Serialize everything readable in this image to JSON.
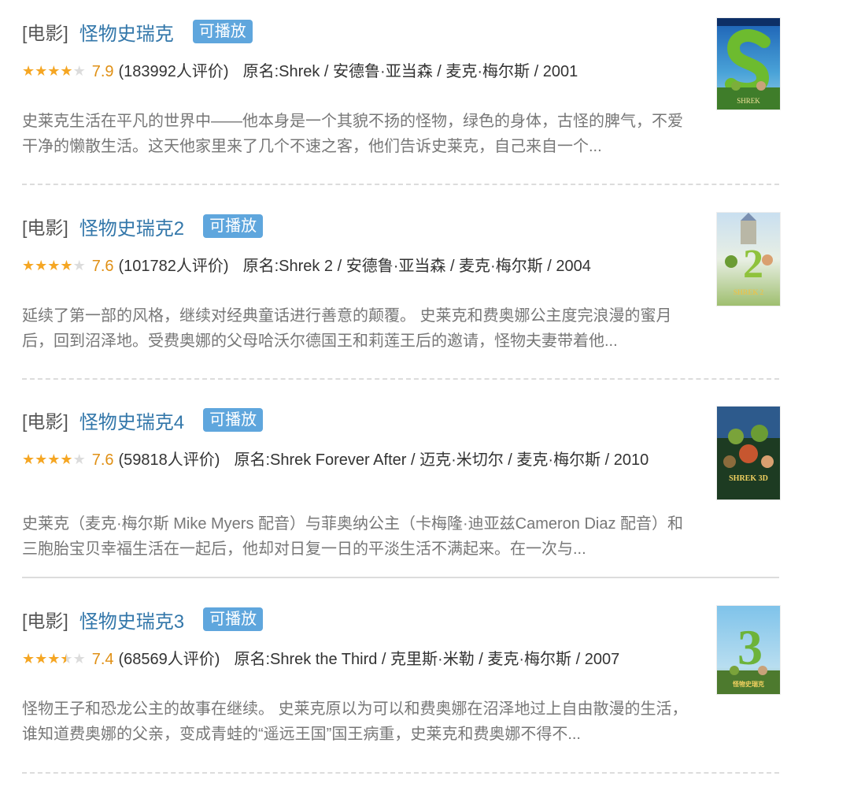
{
  "results": [
    {
      "category": "[电影]",
      "title": "怪物史瑞克",
      "badge": "可播放",
      "rating": 4,
      "score": "7.9",
      "votes": "(183992人评价)",
      "meta": "原名:Shrek / 安德鲁·亚当森 / 麦克·梅尔斯 / 2001",
      "desc": "史莱克生活在平凡的世界中——他本身是一个其貌不扬的怪物，绿色的身体，古怪的脾气，不爱干净的懒散生活。这天他家里来了几个不速之客，他们告诉史莱克，自己来自一个...",
      "poster_text": "SHREK"
    },
    {
      "category": "[电影]",
      "title": "怪物史瑞克2",
      "badge": "可播放",
      "rating": 4,
      "score": "7.6",
      "votes": "(101782人评价)",
      "meta": "原名:Shrek 2 / 安德鲁·亚当森 / 麦克·梅尔斯 / 2004",
      "desc": "延续了第一部的风格，继续对经典童话进行善意的颠覆。 史莱克和费奥娜公主度完浪漫的蜜月后，回到沼泽地。受费奥娜的父母哈沃尔德国王和莉莲王后的邀请，怪物夫妻带着他...",
      "poster_text": "SHREK 2"
    },
    {
      "category": "[电影]",
      "title": "怪物史瑞克4",
      "badge": "可播放",
      "rating": 4,
      "score": "7.6",
      "votes": "(59818人评价)",
      "meta": "原名:Shrek Forever After / 迈克·米切尔 / 麦克·梅尔斯 / 2010",
      "desc": "史莱克（麦克·梅尔斯 Mike Myers 配音）与菲奥纳公主（卡梅隆·迪亚兹Cameron Diaz 配音）和三胞胎宝贝幸福生活在一起后，他却对日复一日的平淡生活不满起来。在一次与...",
      "poster_text": "SHREK 3D"
    },
    {
      "category": "[电影]",
      "title": "怪物史瑞克3",
      "badge": "可播放",
      "rating": 3.5,
      "score": "7.4",
      "votes": "(68569人评价)",
      "meta": "原名:Shrek the Third / 克里斯·米勒 / 麦克·梅尔斯 / 2007",
      "desc": "怪物王子和恐龙公主的故事在继续。 史莱克原以为可以和费奥娜在沼泽地过上自由散漫的生活，谁知道费奥娜的父亲，变成青蛙的“遥远王国”国王病重，史莱克和费奥娜不得不...",
      "poster_text": "怪物史瑞克"
    }
  ]
}
